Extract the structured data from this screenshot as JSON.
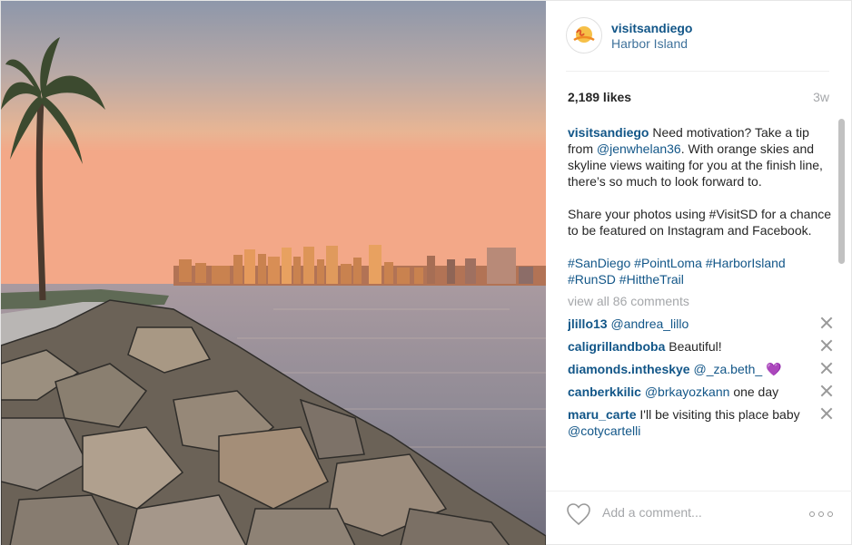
{
  "post": {
    "author": {
      "username": "visitsandiego",
      "location": "Harbor Island",
      "avatar_text": "SanDiego"
    },
    "likes": "2,189 likes",
    "age": "3w",
    "caption": {
      "username": "visitsandiego",
      "text_1": "Need motivation? Take a tip from ",
      "mention": "@jenwhelan36",
      "text_2": ". With orange skies and skyline views waiting for you at the finish line, there’s so much to look forward to.",
      "paragraph_2": "Share your photos using #VisitSD for a chance to be featured on Instagram and Facebook.",
      "hashtags": "#SanDiego #PointLoma #HarborIsland #RunSD #HittheTrail"
    },
    "view_all": "view all 86 comments",
    "comments": [
      {
        "username": "jlillo13",
        "mention": "@andrea_lillo",
        "text": ""
      },
      {
        "username": "caligrillandboba",
        "mention": "",
        "text": "Beautiful!"
      },
      {
        "username": "diamonds.intheskye",
        "mention": "@_za.beth_",
        "text": "💜"
      },
      {
        "username": "canberkkilic",
        "mention": "@brkayozkann",
        "text": "one day"
      },
      {
        "username": "maru_carte",
        "mention": "@cotycartelli",
        "text": "I'll be visiting this place baby "
      }
    ],
    "add_comment_placeholder": "Add a comment..."
  },
  "icons": {
    "heart": "heart-outline-icon",
    "more": "ellipsis-icon",
    "delete": "close-icon"
  },
  "colors": {
    "link": "#125688",
    "location": "#3f729b",
    "muted": "#a5a7aa"
  }
}
